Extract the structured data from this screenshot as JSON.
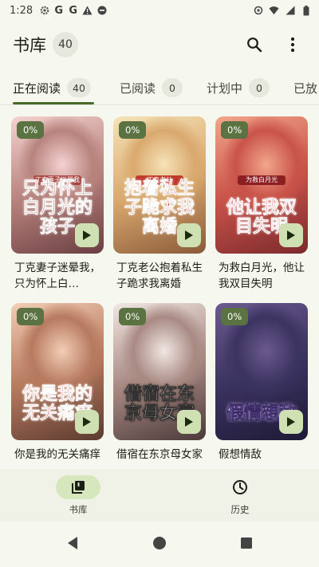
{
  "status_bar": {
    "time": "1:28",
    "left_icons": [
      "settings-gear-icon",
      "g-logo-icon",
      "g-logo-icon",
      "warning-triangle-icon",
      "no-entry-icon"
    ],
    "right_icons": [
      "location-icon",
      "wifi-icon",
      "signal-icon",
      "battery-icon"
    ]
  },
  "top_bar": {
    "title": "书库",
    "count": "40",
    "actions": [
      "search-icon",
      "more-vert-icon"
    ]
  },
  "tabs": [
    {
      "label": "正在阅读",
      "count": "40",
      "active": true
    },
    {
      "label": "已阅读",
      "count": "0",
      "active": false
    },
    {
      "label": "计划中",
      "count": "0",
      "active": false
    },
    {
      "label": "已放",
      "count": "",
      "active": false
    }
  ],
  "books": [
    {
      "name": "丁克妻子迷晕我，只为怀上白…",
      "progress": "0%",
      "cover_title": "只为怀上白月光的孩子",
      "cover_tag": "丁克妻子迷晕我",
      "palette": [
        "#f4d3d1",
        "#b8837d",
        "#6a3f42"
      ]
    },
    {
      "name": "丁克老公抱着私生子跪求我离婚",
      "progress": "0%",
      "cover_title": "抱着私生子跪求我离婚",
      "cover_tag": "丁克老公",
      "palette": [
        "#f6e3b8",
        "#d9a96e",
        "#8a5a3a"
      ]
    },
    {
      "name": "为救白月光，他让我双目失明",
      "progress": "0%",
      "cover_title": "他让我双目失明",
      "cover_tag": "为救白月光",
      "palette": [
        "#f2a68a",
        "#c9534a",
        "#7c2a2c"
      ]
    },
    {
      "name": "你是我的无关痛痒",
      "progress": "0%",
      "cover_title": "你是我的无关痛痒",
      "cover_tag": "",
      "palette": [
        "#f2cdb5",
        "#b77a5f",
        "#5a3a2f"
      ]
    },
    {
      "name": "借宿在东京母女家",
      "progress": "0%",
      "cover_title": "借宿在东京母女家",
      "cover_tag": "",
      "palette": [
        "#f1e7e3",
        "#a98a83",
        "#4b3a3a"
      ]
    },
    {
      "name": "假想情敌",
      "progress": "0%",
      "cover_title": "假情想敌",
      "cover_tag": "",
      "palette": [
        "#6b5a8e",
        "#3b3360",
        "#1f1a36"
      ]
    }
  ],
  "bottom_nav": [
    {
      "label": "书库",
      "icon": "library-books-icon",
      "active": true
    },
    {
      "label": "历史",
      "icon": "history-clock-icon",
      "active": false
    }
  ],
  "system_nav": [
    "back-icon",
    "home-icon",
    "recents-icon"
  ]
}
